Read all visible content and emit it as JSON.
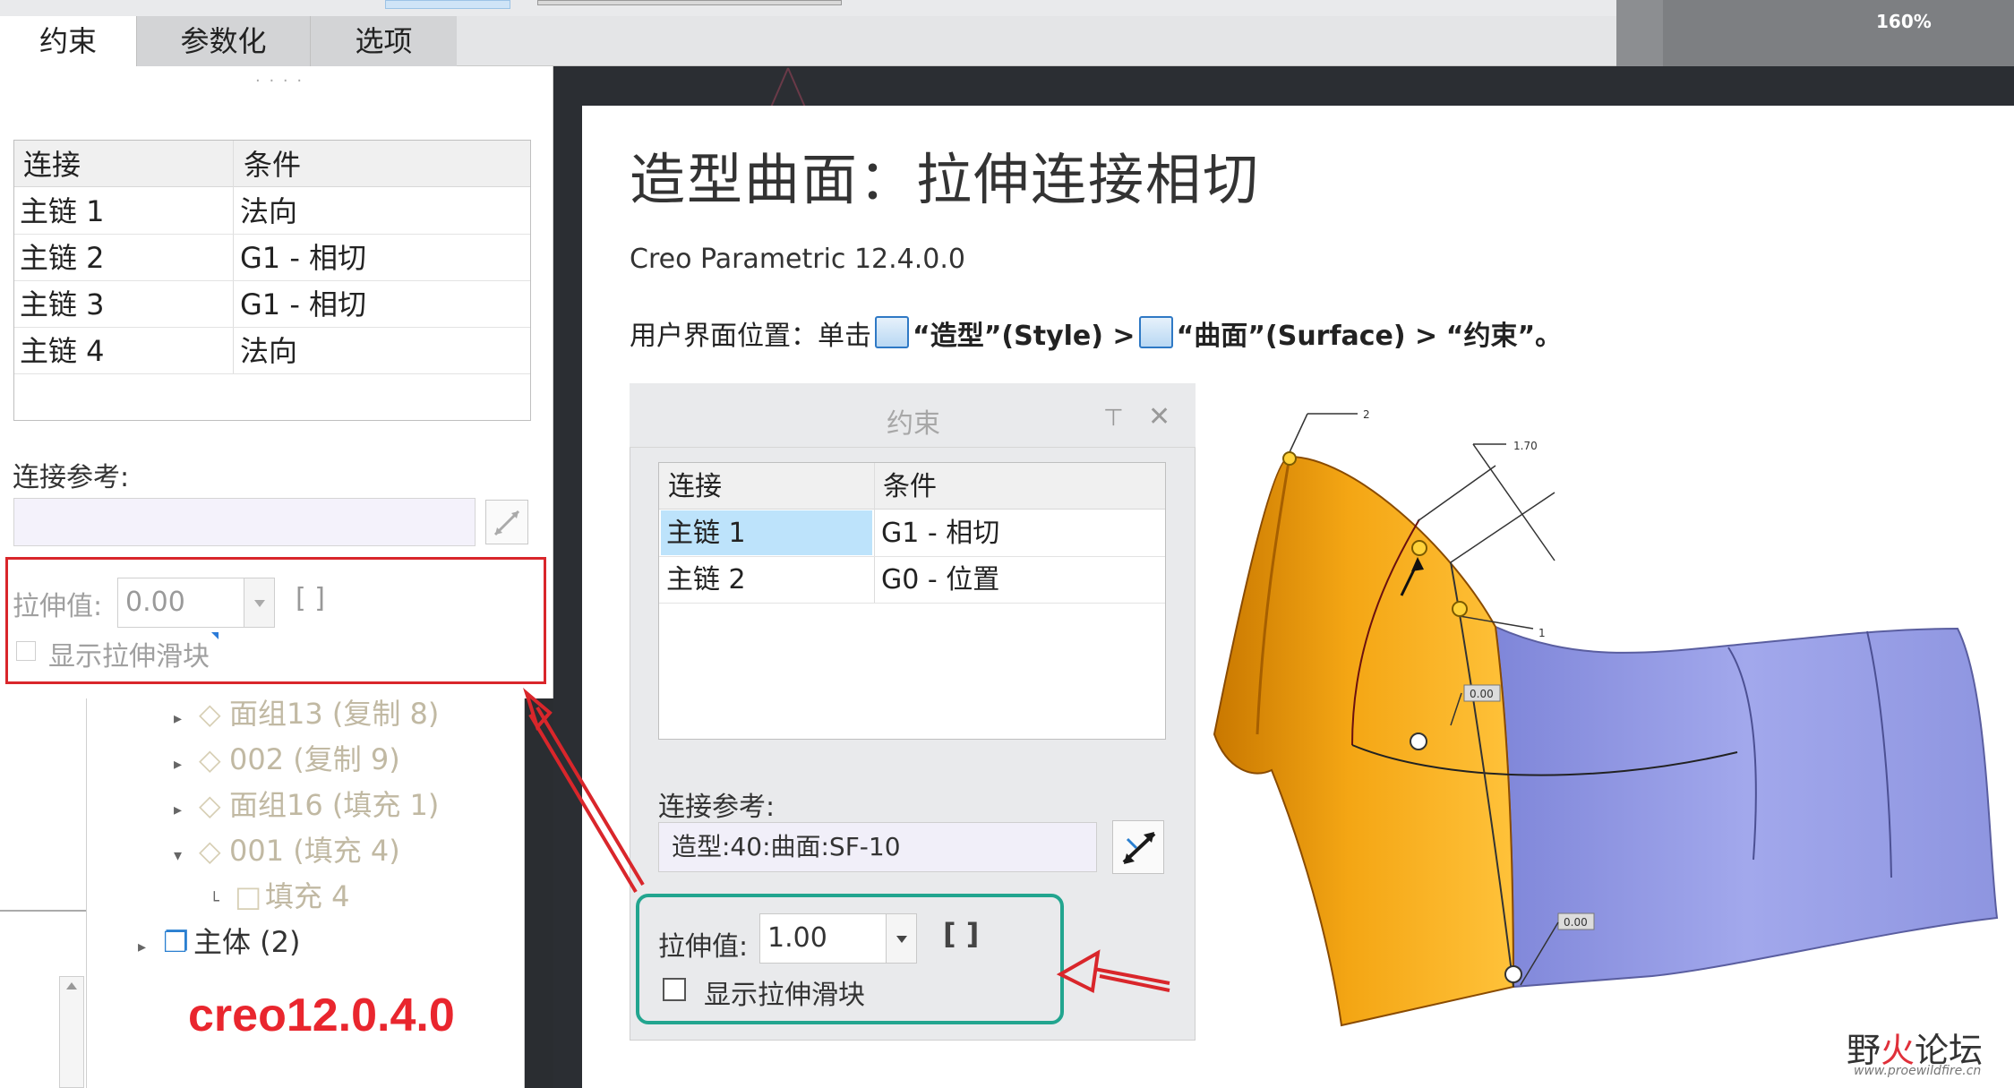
{
  "zoom": "160%",
  "tabs": [
    "约束",
    "参数化",
    "选项"
  ],
  "left_panel": {
    "table": {
      "headers": [
        "连接",
        "条件"
      ],
      "rows": [
        [
          "主链 1",
          "法向"
        ],
        [
          "主链 2",
          "G1 - 相切"
        ],
        [
          "主链 3",
          "G1 - 相切"
        ],
        [
          "主链 4",
          "法向"
        ]
      ]
    },
    "ref_label": "连接参考:",
    "stretch_label": "拉伸值:",
    "stretch_value": "0.00",
    "brackets": "[ ]",
    "show_slider_label": "显示拉伸滑块"
  },
  "tree": {
    "items": [
      {
        "text": "面组13 (复制 8)"
      },
      {
        "text": "002 (复制 9)"
      },
      {
        "text": "面组16 (填充 1)"
      },
      {
        "text": "001 (填充 4)"
      },
      {
        "text": "填充 4"
      },
      {
        "text": "主体 (2)"
      }
    ]
  },
  "version_watermark": "creo12.0.4.0",
  "help": {
    "title": "造型曲面：拉伸连接相切",
    "version": "Creo Parametric 12.4.0.0",
    "path_prefix": "用户界面位置：单击",
    "path_style": "“造型”(Style) >",
    "path_surface": "“曲面”(Surface) >",
    "path_constraint": "“约束”。"
  },
  "dialog": {
    "title": "约束",
    "table": {
      "headers": [
        "连接",
        "条件"
      ],
      "rows": [
        [
          "主链 1",
          "G1 - 相切"
        ],
        [
          "主链 2",
          "G0 - 位置"
        ]
      ]
    },
    "ref_label": "连接参考:",
    "ref_value": "造型:40:曲面:SF-10",
    "stretch_label": "拉伸值:",
    "stretch_value": "1.00",
    "brackets": "[ ]",
    "show_slider_label": "显示拉伸滑块"
  },
  "figure": {
    "dims": [
      "2",
      "1.70",
      "1",
      "0.00",
      "0.00"
    ],
    "surface_left_color": "#f2a20a",
    "surface_right_color": "#9ea4e8"
  },
  "forum": {
    "name_a": "野",
    "name_b": "火",
    "name_c": "论坛",
    "url": "www.proewildfire.cn"
  }
}
